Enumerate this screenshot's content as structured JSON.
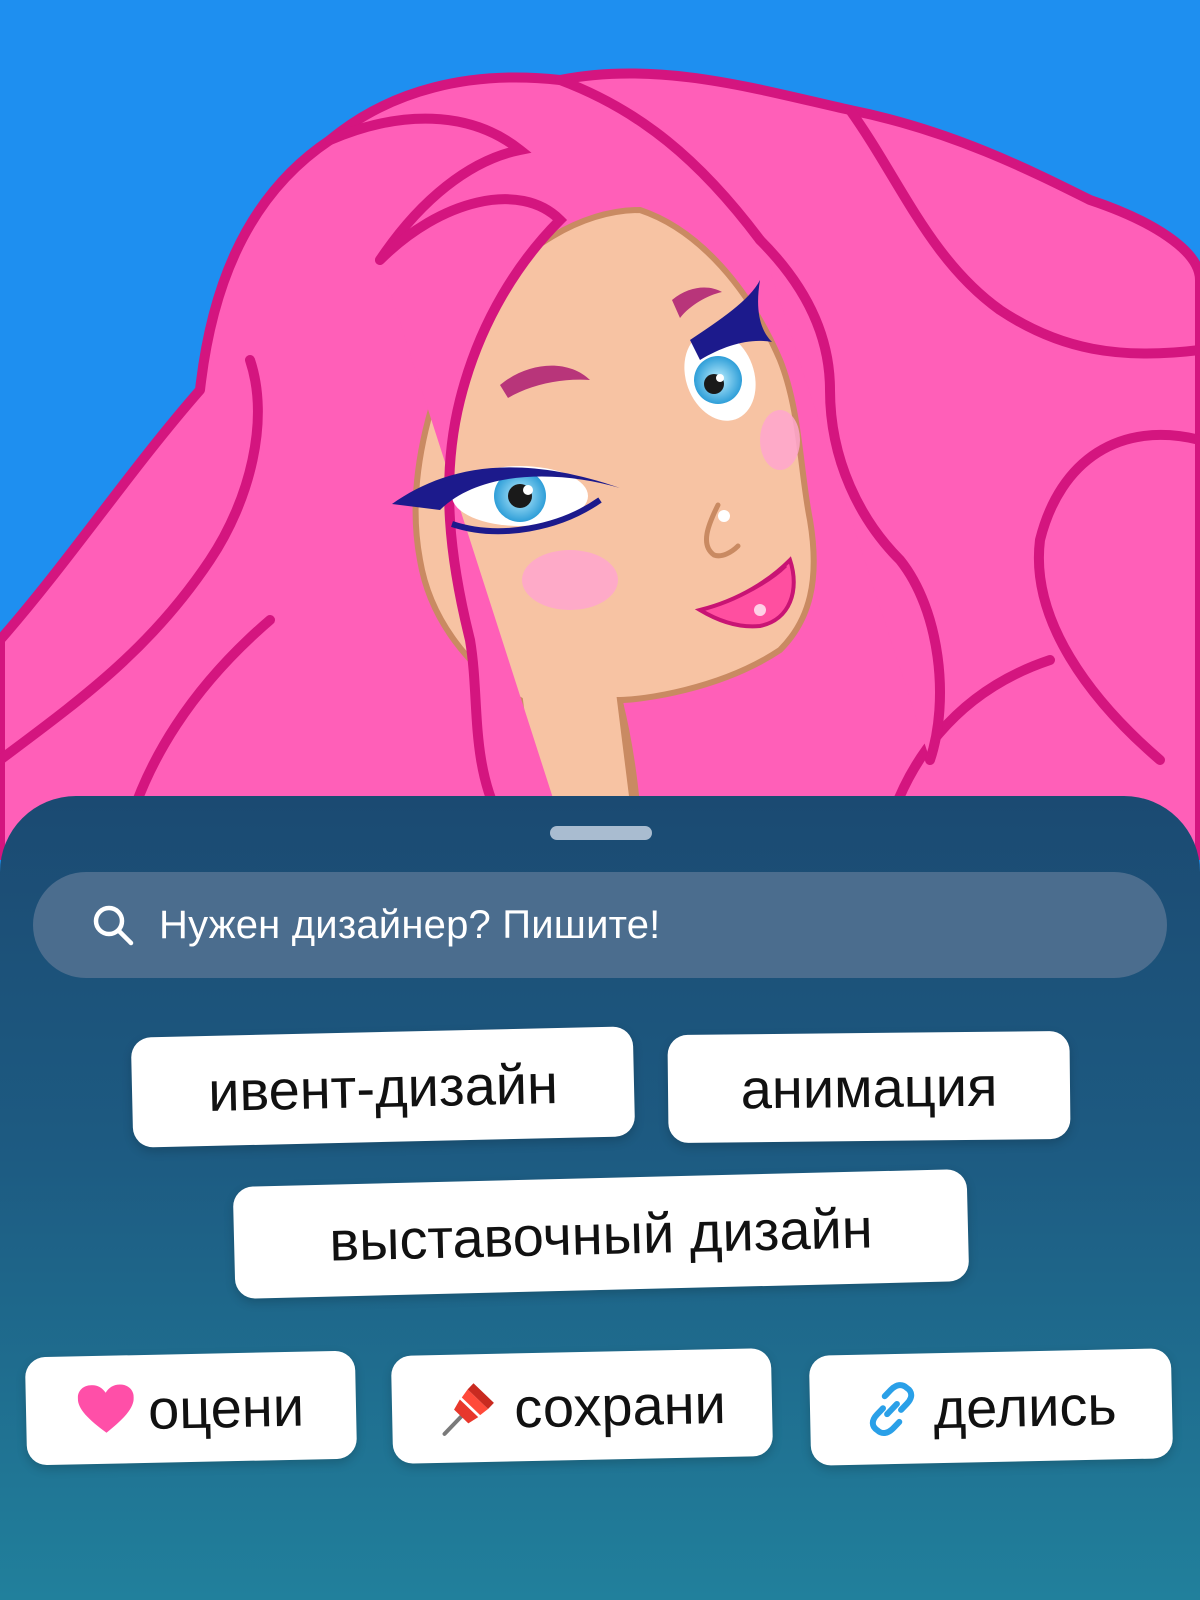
{
  "colors": {
    "background": "#1e8ff0",
    "hair": "#ff5fb8",
    "hair_outline": "#d4157f",
    "skin": "#f7c3a3",
    "sheet_top": "#1b4a72",
    "sheet_bottom": "#21809c",
    "search_bg": "#4b6d8e",
    "chip_bg": "#ffffff",
    "heart": "#ff4fa8",
    "link": "#2aa0e8"
  },
  "search": {
    "icon": "search-icon",
    "text": "Нужен дизайнер? Пишите!"
  },
  "tags": [
    {
      "label": "ивент-дизайн"
    },
    {
      "label": "анимация"
    },
    {
      "label": "выставочный дизайн"
    }
  ],
  "actions": [
    {
      "label": "оцени",
      "icon": "heart-icon"
    },
    {
      "label": "сохрани",
      "icon": "pushpin-icon"
    },
    {
      "label": "делись",
      "icon": "link-icon"
    }
  ]
}
